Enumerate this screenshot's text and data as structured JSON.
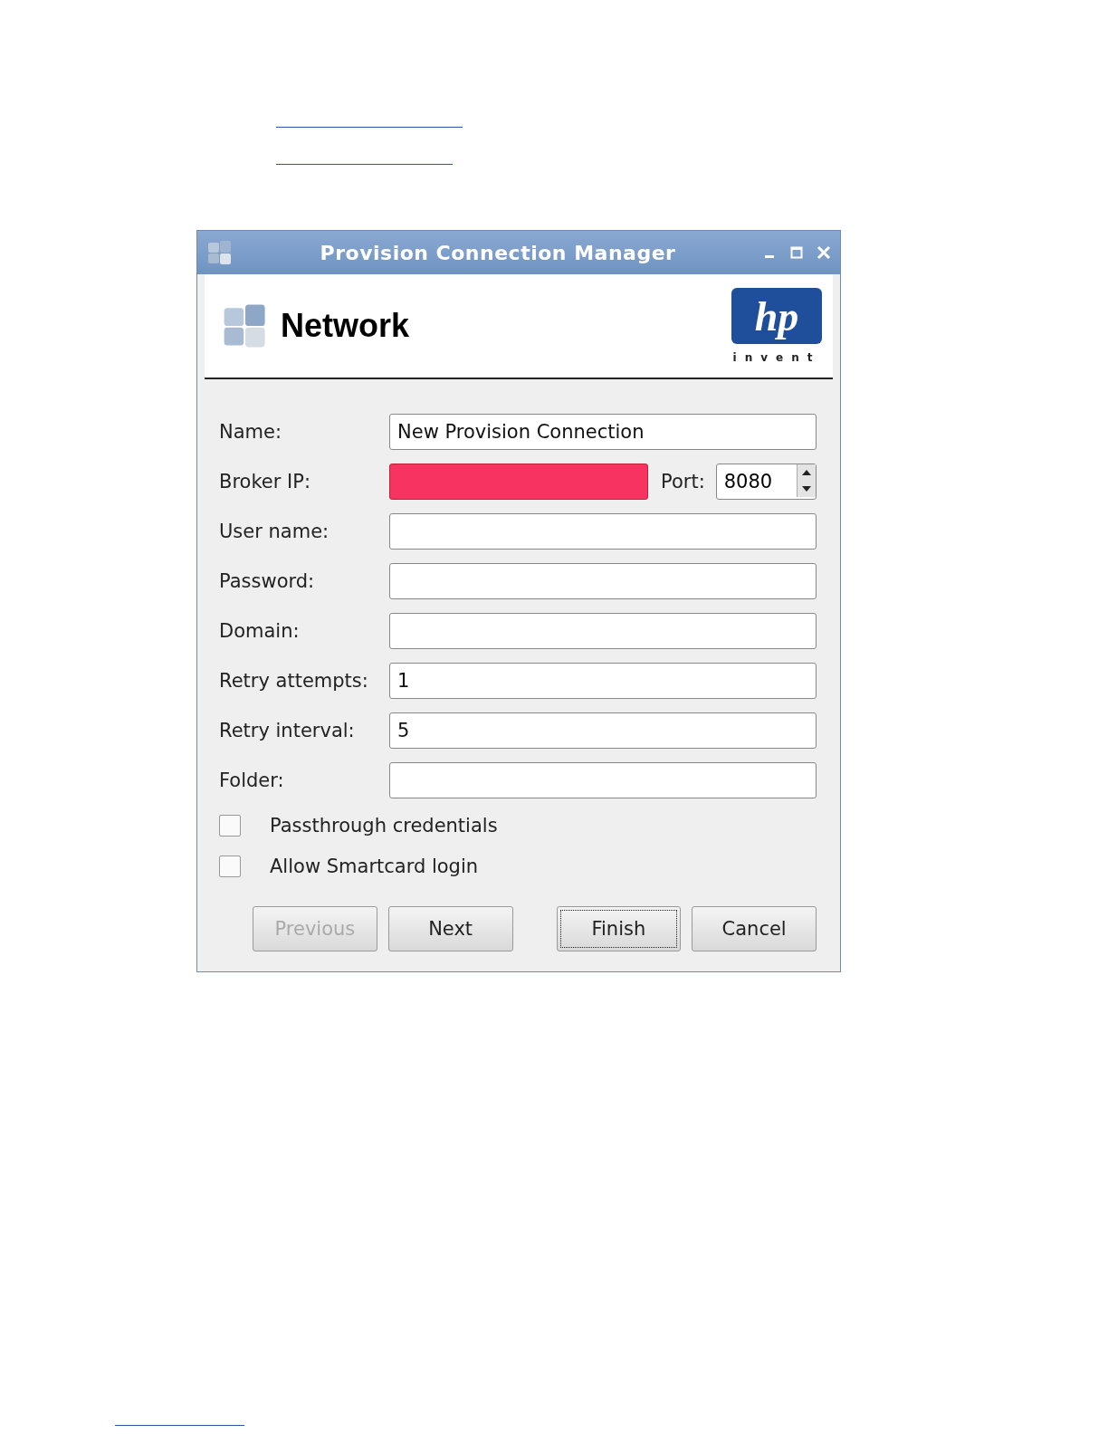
{
  "window": {
    "title": "Provision Connection Manager"
  },
  "header": {
    "title": "Network",
    "logo": {
      "mark": "hp",
      "tagline": "invent"
    }
  },
  "fields": [
    {
      "kind": "text",
      "label": "Name:",
      "value": "New Provision Connection",
      "invalid": false
    },
    {
      "kind": "ip",
      "label": "Broker IP:",
      "invalid": true,
      "port": {
        "label": "Port:",
        "value": "8080"
      }
    },
    {
      "kind": "text",
      "label": "User name:",
      "invalid": false
    },
    {
      "kind": "password",
      "label": "Password:",
      "invalid": false
    },
    {
      "kind": "text",
      "label": "Domain:",
      "invalid": false
    },
    {
      "kind": "text",
      "label": "Retry attempts:",
      "value": "1",
      "invalid": false
    },
    {
      "kind": "text",
      "label": "Retry interval:",
      "value": "5",
      "invalid": false
    },
    {
      "kind": "text",
      "label": "Folder:",
      "invalid": false
    }
  ],
  "checkboxes": [
    {
      "label": "Passthrough credentials",
      "checked": false
    },
    {
      "label": "Allow Smartcard login",
      "checked": false
    }
  ],
  "buttons": [
    {
      "label": "Previous",
      "disabled": true,
      "focused": false
    },
    {
      "label": "Next",
      "disabled": false,
      "focused": false
    },
    {
      "label": "Finish",
      "disabled": false,
      "focused": true
    },
    {
      "label": "Cancel",
      "disabled": false,
      "focused": false
    }
  ]
}
